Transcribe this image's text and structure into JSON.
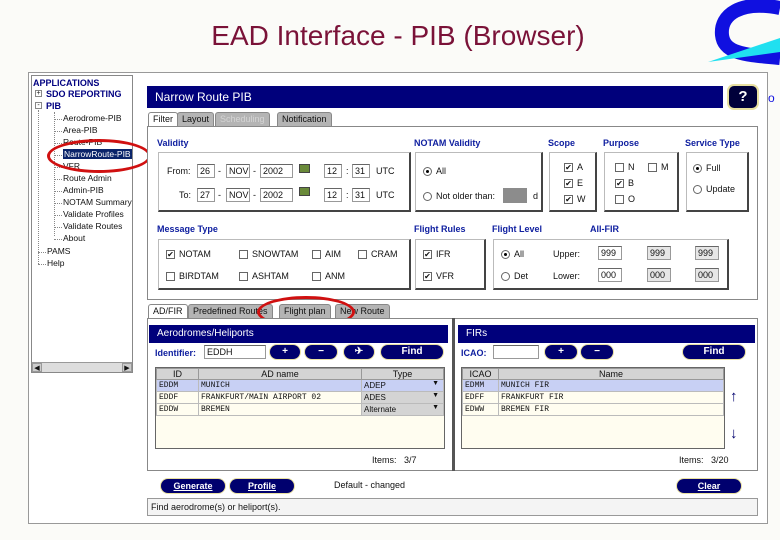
{
  "slide_title": "EAD Interface - PIB (Browser)",
  "tree": {
    "root": "APPLICATIONS",
    "items": [
      {
        "label": "SDO REPORTING",
        "expander": "+"
      },
      {
        "label": "PIB",
        "expander": "-"
      }
    ],
    "pib_children": [
      "Aerodrome-PIB",
      "Area-PIB",
      "Route-PIB",
      "NarrowRoute-PIB",
      "VFR",
      "Route Admin",
      "Admin-PIB",
      "NOTAM Summary",
      "Validate Profiles",
      "Validate Routes",
      "About"
    ],
    "selected": "NarrowRoute-PIB",
    "other": [
      "PAMS",
      "Help"
    ]
  },
  "header": {
    "title": "Narrow Route PIB",
    "help": "?"
  },
  "tabs": [
    {
      "label": "Filter",
      "state": "active"
    },
    {
      "label": "Layout",
      "state": "normal"
    },
    {
      "label": "Scheduling",
      "state": "disabled"
    },
    {
      "label": "Notification",
      "state": "normal"
    }
  ],
  "validity": {
    "label": "Validity",
    "from_label": "From:",
    "to_label": "To:",
    "from": {
      "day": "26",
      "month": "NOV",
      "year": "2002",
      "hour": "12",
      "min": "31"
    },
    "to": {
      "day": "27",
      "month": "NOV",
      "year": "2002",
      "hour": "12",
      "min": "31"
    },
    "sep": "-",
    "colon": ":",
    "utc": "UTC"
  },
  "notam_validity": {
    "label": "NOTAM Validity",
    "all": "All",
    "older": "Not older than:",
    "unit": "d",
    "selected": "All"
  },
  "scope": {
    "label": "Scope",
    "items": [
      {
        "label": "A",
        "checked": true
      },
      {
        "label": "E",
        "checked": true
      },
      {
        "label": "W",
        "checked": true
      }
    ]
  },
  "purpose": {
    "label": "Purpose",
    "items": [
      {
        "label": "N",
        "checked": false
      },
      {
        "label": "M",
        "checked": false
      },
      {
        "label": "B",
        "checked": true
      },
      {
        "label": "O",
        "checked": false
      }
    ]
  },
  "service_type": {
    "label": "Service Type",
    "full": "Full",
    "update": "Update",
    "selected": "Full"
  },
  "message_type": {
    "label": "Message Type",
    "items": [
      {
        "label": "NOTAM",
        "checked": true
      },
      {
        "label": "SNOWTAM",
        "checked": false
      },
      {
        "label": "AIM",
        "checked": false
      },
      {
        "label": "CRAM",
        "checked": false
      },
      {
        "label": "BIRDTAM",
        "checked": false
      },
      {
        "label": "ASHTAM",
        "checked": false
      },
      {
        "label": "ANM",
        "checked": false
      }
    ]
  },
  "flight_rules": {
    "label": "Flight Rules",
    "items": [
      {
        "label": "IFR",
        "checked": true
      },
      {
        "label": "VFR",
        "checked": true
      }
    ]
  },
  "flight_level": {
    "label": "Flight Level",
    "all_fir": "All-FIR",
    "all": "All",
    "det": "Det",
    "upper": "Upper:",
    "lower": "Lower:",
    "upper_vals": [
      "999",
      "999",
      "999"
    ],
    "lower_vals": [
      "000",
      "000",
      "000"
    ]
  },
  "lower_tabs": [
    {
      "label": "AD/FIR"
    },
    {
      "label": "Predefined Routes"
    },
    {
      "label": "Flight plan"
    },
    {
      "label": "New Route"
    }
  ],
  "aerodromes": {
    "title": "Aerodromes/Heliports",
    "id_label": "Identifier:",
    "id_value": "EDDH",
    "find": "Find",
    "plus": "+",
    "minus": "−",
    "plane": "✈",
    "columns": [
      "ID",
      "AD name",
      "Type"
    ],
    "rows": [
      [
        "EDDM",
        "MUNICH",
        "ADEP"
      ],
      [
        "EDDF",
        "FRANKFURT/MAIN AIRPORT 02",
        "ADES"
      ],
      [
        "EDDW",
        "BREMEN",
        "Alternate"
      ]
    ],
    "items_label": "Items:",
    "items": "3/7"
  },
  "firs": {
    "title": "FIRs",
    "icao_label": "ICAO:",
    "icao_value": "",
    "find": "Find",
    "plus": "+",
    "minus": "−",
    "columns": [
      "ICAO",
      "Name"
    ],
    "rows": [
      [
        "EDMM",
        "MUNICH FIR"
      ],
      [
        "EDFF",
        "FRANKFURT FIR"
      ],
      [
        "EDWW",
        "BREMEN FIR"
      ]
    ],
    "items_label": "Items:",
    "items": "3/20",
    "up": "↑",
    "down": "↓"
  },
  "footer": {
    "generate": "Generate",
    "profile": "Profile",
    "status": "Default - changed",
    "clear": "Clear",
    "message": "Find aerodrome(s) or heliport(s)."
  }
}
